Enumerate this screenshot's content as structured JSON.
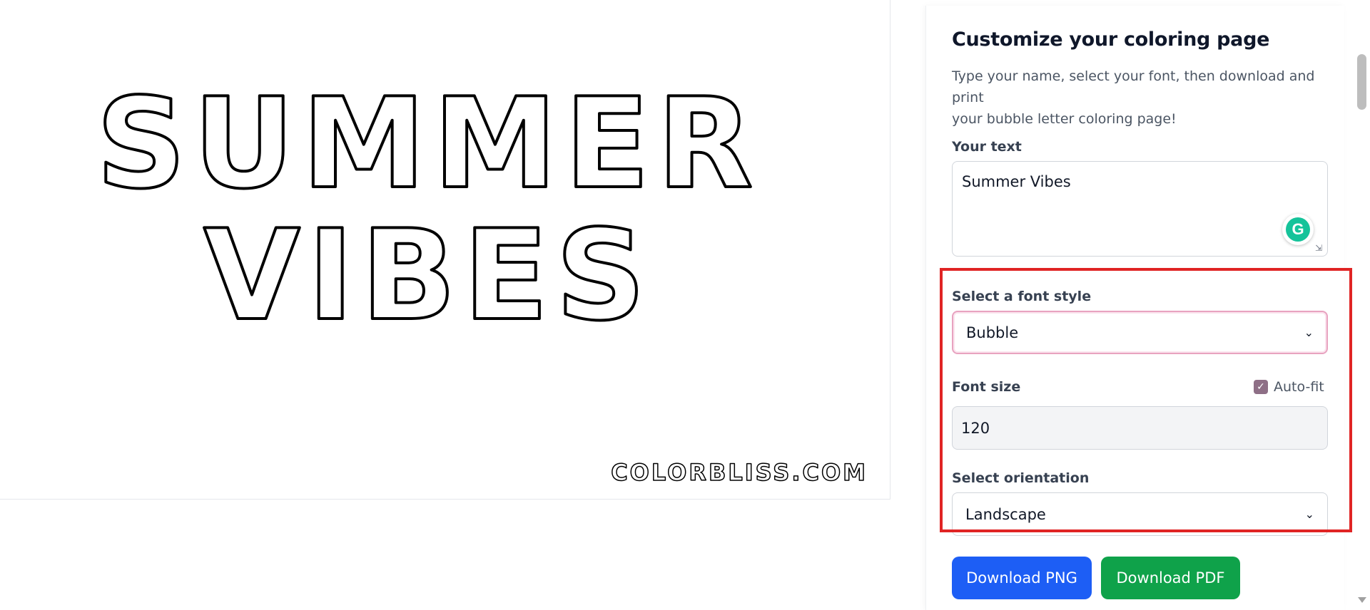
{
  "preview": {
    "line1": "SUMMER",
    "line2": "VIBES",
    "watermark": "COLORBLISS.COM"
  },
  "panel": {
    "title": "Customize your coloring page",
    "subtitle_line1": "Type your name, select your font, then download and print",
    "subtitle_line2": "your bubble letter coloring page!",
    "text_label": "Your text",
    "text_value": "Summer Vibes",
    "font_style_label": "Select a font style",
    "font_style_value": "Bubble",
    "font_size_label": "Font size",
    "autofit_label": "Auto-fit",
    "autofit_checked": true,
    "font_size_value": "120",
    "orientation_label": "Select orientation",
    "orientation_value": "Landscape",
    "download_png": "Download PNG",
    "download_pdf": "Download PDF"
  },
  "colors": {
    "png_button": "#1d5ef5",
    "pdf_button": "#0fa24a",
    "highlight": "#e02424",
    "checkbox": "#8e6f86"
  },
  "icons": {
    "grammarly": "G",
    "chevron": "chevron-down-icon",
    "checkmark": "check-icon"
  }
}
